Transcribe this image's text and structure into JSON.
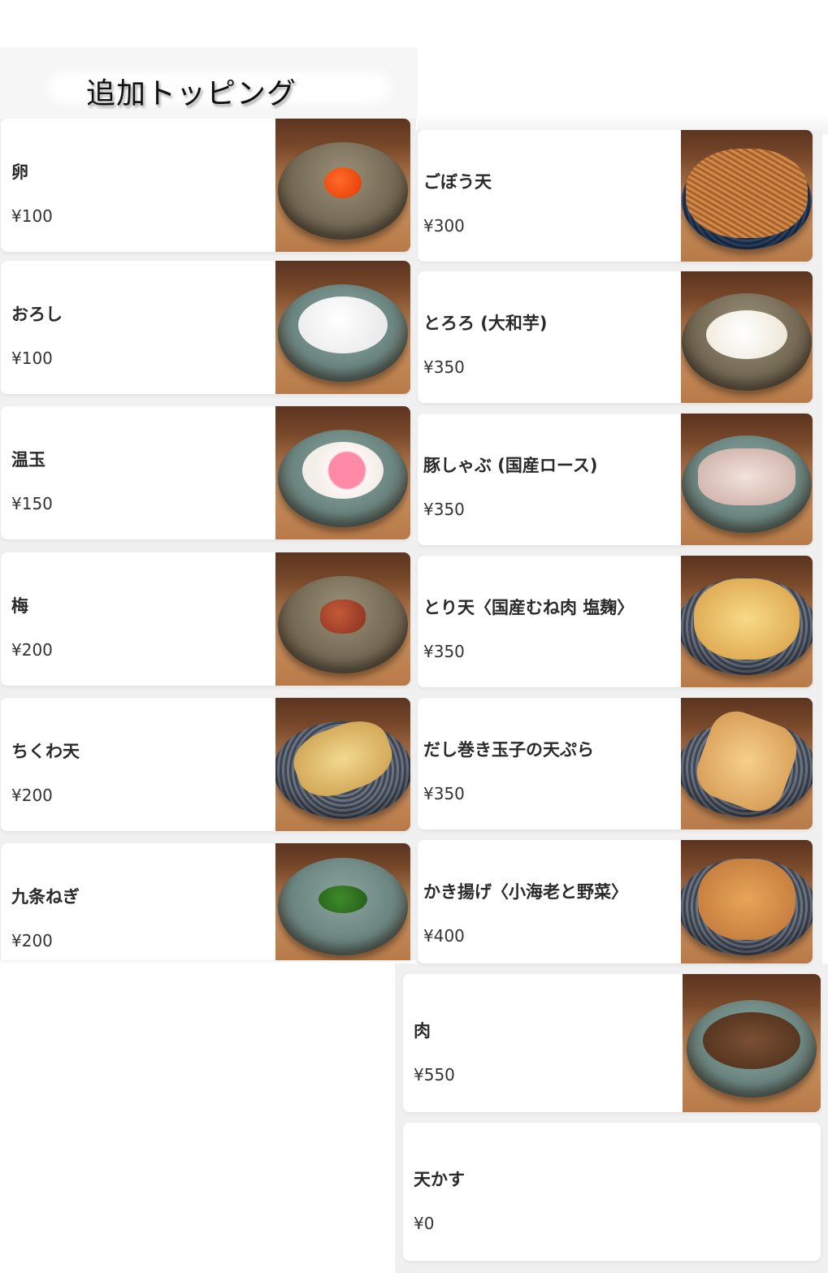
{
  "page": {
    "title": "追加トッピング"
  },
  "menu": {
    "left_items": [
      {
        "name": "卵",
        "price": "¥100",
        "dish": "yolk",
        "dish_style": "bowl"
      },
      {
        "name": "おろし",
        "price": "¥100",
        "dish": "oroshi",
        "dish_style": "green"
      },
      {
        "name": "温玉",
        "price": "¥150",
        "dish": "onsen",
        "dish_style": "green"
      },
      {
        "name": "梅",
        "price": "¥200",
        "dish": "ume",
        "dish_style": "bowl"
      },
      {
        "name": "ちくわ天",
        "price": "¥200",
        "dish": "chikuwa",
        "dish_style": "plate"
      },
      {
        "name": "九条ねぎ",
        "price": "¥200",
        "dish": "negi",
        "dish_style": "green"
      }
    ],
    "right_items": [
      {
        "name": "ごぼう天",
        "price": "¥300",
        "dish": "gobo",
        "dish_style": "blue"
      },
      {
        "name": "とろろ (大和芋)",
        "price": "¥350",
        "dish": "tororo",
        "dish_style": "bowl"
      },
      {
        "name": "豚しゃぶ (国産ロース)",
        "price": "¥350",
        "dish": "pork",
        "dish_style": "green"
      },
      {
        "name": "とり天〈国産むね肉 塩麹〉",
        "price": "¥350",
        "dish": "toriten",
        "dish_style": "plate"
      },
      {
        "name": "だし巻き玉子の天ぷら",
        "price": "¥350",
        "dish": "dashimaki",
        "dish_style": "plate"
      },
      {
        "name": "かき揚げ〈小海老と野菜〉",
        "price": "¥400",
        "dish": "kakiage",
        "dish_style": "plate"
      }
    ],
    "bottom_items": [
      {
        "name": "肉",
        "price": "¥550",
        "dish": "meat",
        "dish_style": "green",
        "has_image": true
      },
      {
        "name": "天かす",
        "price": "¥0",
        "has_image": false
      }
    ]
  }
}
